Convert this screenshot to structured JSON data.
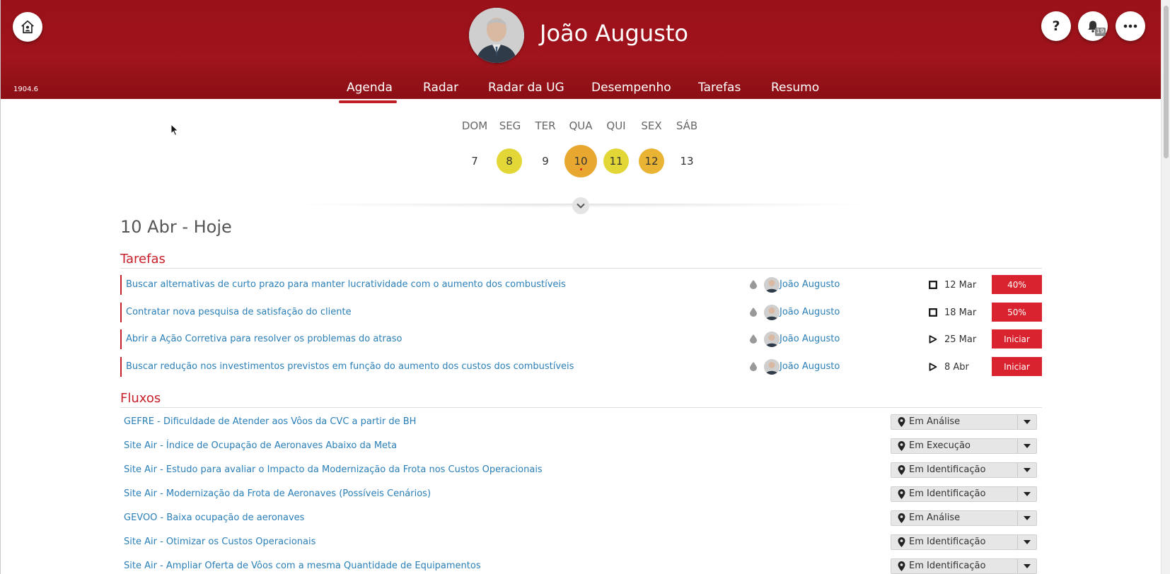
{
  "header": {
    "version": "1904.6",
    "user_name": "João Augusto",
    "notification_count": "19",
    "help_label": "?"
  },
  "nav": {
    "items": [
      {
        "label": "Agenda",
        "active": true
      },
      {
        "label": "Radar"
      },
      {
        "label": "Radar da UG"
      },
      {
        "label": "Desempenho"
      },
      {
        "label": "Tarefas"
      },
      {
        "label": "Resumo"
      }
    ]
  },
  "week": {
    "day_names": [
      "DOM",
      "SEG",
      "TER",
      "QUA",
      "QUI",
      "SEX",
      "SÁB"
    ],
    "days": [
      "7",
      "8",
      "9",
      "10",
      "11",
      "12",
      "13"
    ]
  },
  "date_title": "10 Abr - Hoje",
  "tasks_section": {
    "title": "Tarefas",
    "rows": [
      {
        "title": "Buscar alternativas de curto prazo para manter lucratividade com o aumento dos combustíveis",
        "owner": "João Augusto",
        "date": "12 Mar",
        "action": "40%"
      },
      {
        "title": "Contratar nova pesquisa de satisfação do cliente",
        "owner": "João Augusto",
        "date": "18 Mar",
        "action": "50%"
      },
      {
        "title": "Abrir a Ação Corretiva para resolver os problemas do atraso",
        "owner": "João Augusto",
        "date": "25 Mar",
        "action": "Iniciar"
      },
      {
        "title": "Buscar redução nos investimentos previstos em função do aumento dos custos dos combustíveis",
        "owner": "João Augusto",
        "date": "8 Abr",
        "action": "Iniciar"
      }
    ]
  },
  "flows_section": {
    "title": "Fluxos",
    "rows": [
      {
        "title": "GEFRE - Dificuldade de Atender aos Vôos da CVC a partir de BH",
        "status": "Em Análise"
      },
      {
        "title": "Site Air - Índice de Ocupação de Aeronaves Abaixo da Meta",
        "status": "Em Execução"
      },
      {
        "title": "Site Air - Estudo para avaliar o Impacto da Modernização da Frota nos Custos Operacionais",
        "status": "Em Identificação"
      },
      {
        "title": "Site Air - Modernização da Frota de Aeronaves (Possíveis Cenários)",
        "status": "Em Identificação"
      },
      {
        "title": "GEVOO - Baixa ocupação de aeronaves",
        "status": "Em Análise"
      },
      {
        "title": "Site Air - Otimizar os Custos Operacionais",
        "status": "Em Identificação"
      },
      {
        "title": "Site Air - Ampliar Oferta de Vôos com a mesma Quantidade de Equipamentos",
        "status": "Em Identificação"
      }
    ]
  },
  "colors": {
    "brand_red": "#9a1119",
    "accent_red": "#d9232e",
    "link_blue": "#2a7fb8",
    "day_yellow": "#e2d736",
    "day_orange": "#e9b333"
  }
}
